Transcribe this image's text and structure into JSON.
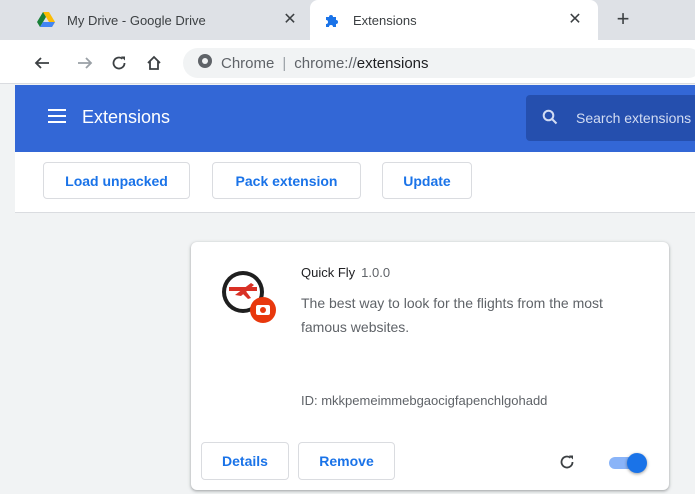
{
  "tabs": [
    {
      "title": "My Drive - Google Drive",
      "icon": "google-drive-icon",
      "active": false
    },
    {
      "title": "Extensions",
      "icon": "puzzle-piece-icon",
      "active": true
    }
  ],
  "new_tab_label": "+",
  "omnibox": {
    "site_label": "Chrome",
    "separator": "|",
    "scheme": "chrome://",
    "host": "extensions"
  },
  "header": {
    "title": "Extensions",
    "search_placeholder": "Search extensions"
  },
  "dev_toolbar": {
    "load_unpacked": "Load unpacked",
    "pack_extension": "Pack extension",
    "update": "Update"
  },
  "extension": {
    "name": "Quick Fly",
    "version": "1.0.0",
    "description": "The best way to look for the flights from the most famous websites.",
    "id_text": "ID: mkkpemeimmebgaocigfapenchlgohadd",
    "details_label": "Details",
    "remove_label": "Remove",
    "enabled": true
  },
  "colors": {
    "header_blue": "#3367d6",
    "accent": "#1a73e8",
    "icon_red": "#e8380d"
  }
}
